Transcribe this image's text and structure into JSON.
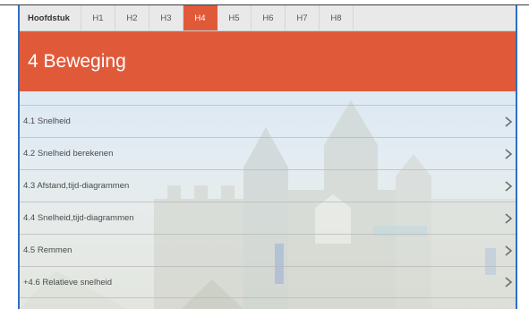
{
  "tabs": [
    {
      "label": "Hoofdstuk",
      "active": false
    },
    {
      "label": "H1",
      "active": false
    },
    {
      "label": "H2",
      "active": false
    },
    {
      "label": "H3",
      "active": false
    },
    {
      "label": "H4",
      "active": true
    },
    {
      "label": "H5",
      "active": false
    },
    {
      "label": "H6",
      "active": false
    },
    {
      "label": "H7",
      "active": false
    },
    {
      "label": "H8",
      "active": false
    }
  ],
  "header": {
    "title": "4 Beweging"
  },
  "sections": [
    {
      "label": "4.1 Snelheid",
      "icon": "chevron-right-icon"
    },
    {
      "label": "4.2 Snelheid berekenen",
      "icon": "chevron-right-icon"
    },
    {
      "label": "4.3 Afstand,tijd-diagrammen",
      "icon": "chevron-right-icon"
    },
    {
      "label": "4.4 Snelheid,tijd-diagrammen",
      "icon": "chevron-right-icon"
    },
    {
      "label": "4.5 Remmen",
      "icon": "chevron-right-icon"
    },
    {
      "label": "+4.6 Relatieve snelheid",
      "icon": "chevron-right-icon"
    }
  ],
  "colors": {
    "accent": "#e05a3a",
    "tabbar": "#e9e9e9",
    "frame_border": "#2f6fc4",
    "text": "#4a4a4a"
  }
}
